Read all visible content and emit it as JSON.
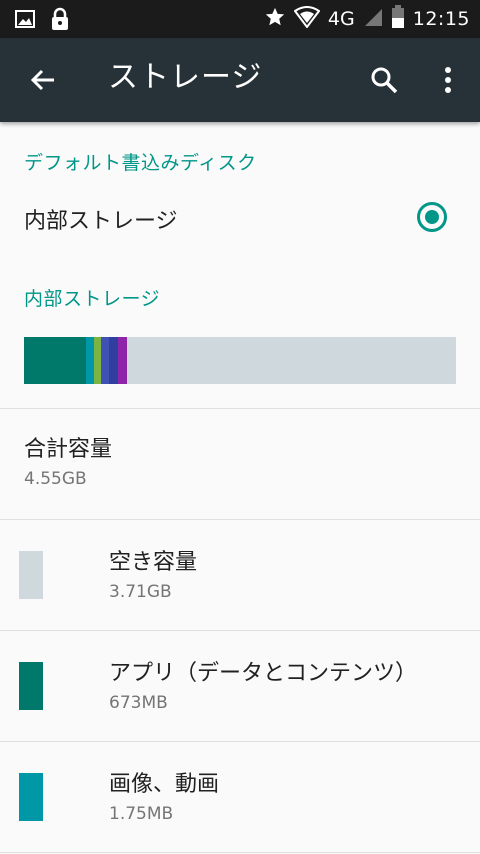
{
  "status_bar": {
    "network": "4G",
    "time": "12:15",
    "icons": [
      "image-icon",
      "lock-icon",
      "star-icon",
      "wifi-icon",
      "signal-icon",
      "battery-icon"
    ]
  },
  "app_bar": {
    "title": "ストレージ",
    "icons": [
      "back-arrow-icon",
      "search-icon",
      "more-vert-icon"
    ],
    "background": "#263238"
  },
  "default_disk": {
    "header": "デフォルト書込みディスク",
    "option_label": "内部ストレージ",
    "selected": true
  },
  "internal_storage": {
    "header": "内部ストレージ",
    "usage_bar": [
      {
        "name": "apps",
        "color": "#00796b",
        "fraction": 0.143
      },
      {
        "name": "images",
        "color": "#0097a7",
        "fraction": 0.02
      },
      {
        "name": "green",
        "color": "#7cb342",
        "fraction": 0.015
      },
      {
        "name": "blue",
        "color": "#3f51b5",
        "fraction": 0.02
      },
      {
        "name": "indigo",
        "color": "#303f9f",
        "fraction": 0.02
      },
      {
        "name": "purple",
        "color": "#8e24aa",
        "fraction": 0.02
      }
    ],
    "bar_background": "#cfd8dc",
    "total": {
      "label": "合計容量",
      "value": "4.55GB"
    },
    "items": [
      {
        "label": "空き容量",
        "value": "3.71GB",
        "color": "#cfd8dc"
      },
      {
        "label": "アプリ（データとコンテンツ）",
        "value": "673MB",
        "color": "#00796b"
      },
      {
        "label": "画像、動画",
        "value": "1.75MB",
        "color": "#0097a7"
      }
    ]
  },
  "accent": "#009688"
}
